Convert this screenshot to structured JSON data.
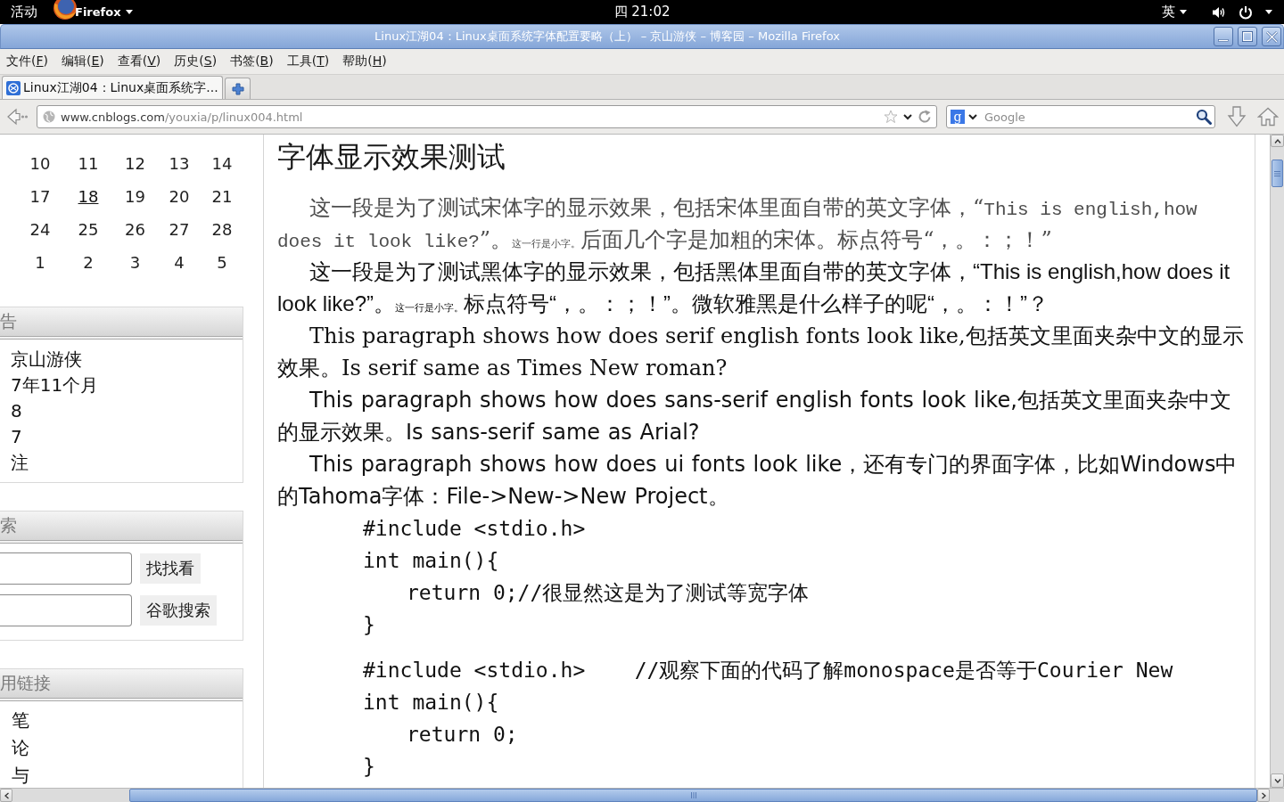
{
  "top_bar": {
    "activities": "活动",
    "app_menu": "Firefox",
    "clock": "四 21:02",
    "input_method": "英"
  },
  "window": {
    "title": "Linux江湖04：Linux桌面系统字体配置要略（上） – 京山游侠 – 博客园 – Mozilla Firefox"
  },
  "menu_bar": [
    {
      "before": "文件(",
      "mnemonic": "F",
      "after": ")"
    },
    {
      "before": "编辑(",
      "mnemonic": "E",
      "after": ")"
    },
    {
      "before": "查看(",
      "mnemonic": "V",
      "after": ")"
    },
    {
      "before": "历史(",
      "mnemonic": "S",
      "after": ")"
    },
    {
      "before": "书签(",
      "mnemonic": "B",
      "after": ")"
    },
    {
      "before": "工具(",
      "mnemonic": "T",
      "after": ")"
    },
    {
      "before": "帮助(",
      "mnemonic": "H",
      "after": ")"
    }
  ],
  "tabs": [
    {
      "label": "Linux江湖04：Linux桌面系统字...",
      "selected": true
    }
  ],
  "address_bar": {
    "domain": "www.cnblogs.com",
    "path": "/youxia/p/linux004.html"
  },
  "search_bar": {
    "engine_badge": "g",
    "placeholder": "Google"
  },
  "sidebar": {
    "calendar": {
      "weeks": [
        [
          {
            "day": "10",
            "linked": false
          },
          {
            "day": "11",
            "linked": false
          },
          {
            "day": "12",
            "linked": false
          },
          {
            "day": "13",
            "linked": false
          },
          {
            "day": "14",
            "linked": false
          }
        ],
        [
          {
            "day": "17",
            "linked": false
          },
          {
            "day": "18",
            "linked": true
          },
          {
            "day": "19",
            "linked": false
          },
          {
            "day": "20",
            "linked": false
          },
          {
            "day": "21",
            "linked": false
          }
        ],
        [
          {
            "day": "24",
            "linked": false
          },
          {
            "day": "25",
            "linked": false
          },
          {
            "day": "26",
            "linked": false
          },
          {
            "day": "27",
            "linked": false
          },
          {
            "day": "28",
            "linked": false
          }
        ],
        [
          {
            "day": "1",
            "linked": false
          },
          {
            "day": "2",
            "linked": false
          },
          {
            "day": "3",
            "linked": false
          },
          {
            "day": "4",
            "linked": false
          },
          {
            "day": "5",
            "linked": false
          }
        ]
      ]
    },
    "sections": [
      {
        "kind": "info",
        "heading": "告",
        "items": [
          "京山游侠",
          "7年11个月",
          "8",
          "7",
          "注"
        ]
      },
      {
        "kind": "search",
        "heading": "索",
        "rows": [
          {
            "button": "找找看"
          },
          {
            "button": "谷歌搜索"
          }
        ]
      },
      {
        "kind": "links",
        "heading": "用链接",
        "items": [
          "笔",
          "论",
          "与"
        ]
      }
    ]
  },
  "article": {
    "heading": "字体显示效果测试",
    "paragraphs": [
      {
        "kind": "song",
        "segments": [
          {
            "kind": "text",
            "text": "这一段是为了测试宋体字的显示效果，包括宋体里面自带的英文字体，“"
          },
          {
            "kind": "mono",
            "text": "This is english,how does it look like?"
          },
          {
            "kind": "text",
            "text": "”。"
          },
          {
            "kind": "small",
            "text": "这一行是小字。"
          },
          {
            "kind": "text",
            "text": "后面几个字是加粗的宋体。标点符号“，。：；！”"
          }
        ]
      },
      {
        "kind": "hei",
        "segments": [
          {
            "kind": "text",
            "text": "这一段是为了测试黑体字的显示效果，包括黑体里面自带的英文字体，“This is english,how does it look like?”。"
          },
          {
            "kind": "small",
            "text": "这一行是小字。"
          },
          {
            "kind": "text",
            "text": "标点符号“，。：；！”。微软雅黑是什么样子的呢“，。：！”？"
          }
        ]
      },
      {
        "kind": "serif",
        "segments": [
          {
            "kind": "text",
            "text": "This paragraph shows how does serif english fonts look like,包括英文里面夹杂中文的显示效果。Is serif same as Times New roman?"
          }
        ]
      },
      {
        "kind": "sans",
        "segments": [
          {
            "kind": "text",
            "text": "This paragraph shows how does sans-serif english fonts look like,包括英文里面夹杂中文的显示效果。Is sans-serif same as Arial?"
          }
        ]
      },
      {
        "kind": "ui",
        "segments": [
          {
            "kind": "text",
            "text": "This paragraph shows how does ui fonts look like，还有专门的界面字体，比如Windows中的Tahoma字体：File->New->New Project。"
          }
        ]
      }
    ],
    "code_blocks": [
      {
        "lines": [
          {
            "text": "#include <stdio.h>"
          },
          {
            "text": "int main(){",
            "children": [
              {
                "text": "return 0;//很显然这是为了测试等宽字体"
              }
            ]
          },
          {
            "text": "}"
          }
        ]
      },
      {
        "lines": [
          {
            "text": "#include <stdio.h>    //观察下面的代码了解monospace是否等于Courier New"
          },
          {
            "text": "int main(){",
            "children": [
              {
                "text": "return 0;"
              }
            ]
          },
          {
            "text": "}"
          }
        ]
      }
    ]
  }
}
